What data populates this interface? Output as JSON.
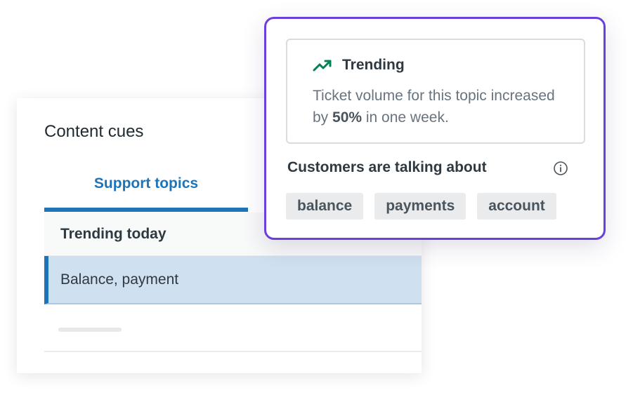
{
  "cues_panel": {
    "title": "Content cues",
    "tab_label": "Support topics",
    "section_header": "Trending today",
    "selected_row": "Balance, payment"
  },
  "popover": {
    "trend_title": "Trending",
    "trend_desc_prefix": "Ticket volume for this topic increased by ",
    "trend_percent": "50%",
    "trend_desc_suffix": " in one week.",
    "talking_label": "Customers are talking about",
    "tags": [
      "balance",
      "payments",
      "account"
    ]
  },
  "colors": {
    "accent_purple": "#6b3fdc",
    "tab_blue": "#1f73b7",
    "trend_green": "#038153",
    "selected_row_bg": "#cfe0f0"
  },
  "icons": {
    "trend": "trending-up-icon",
    "info": "info-icon"
  }
}
